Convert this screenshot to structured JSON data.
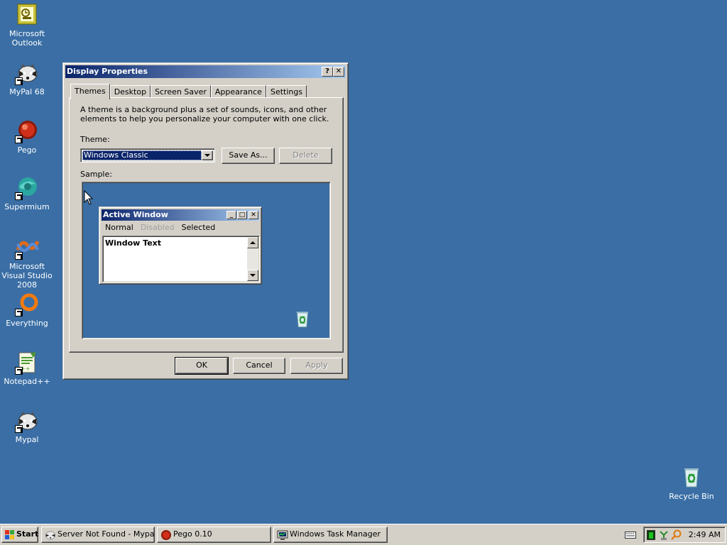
{
  "desktop": {
    "icons": [
      {
        "label": "Microsoft Outlook",
        "icon": "outlook-icon"
      },
      {
        "label": "MyPal 68",
        "icon": "mypal-icon"
      },
      {
        "label": "Pego",
        "icon": "pego-icon"
      },
      {
        "label": "Supermium",
        "icon": "supermium-icon"
      },
      {
        "label": "Microsoft Visual Studio 2008",
        "icon": "visual-studio-icon"
      },
      {
        "label": "Everything",
        "icon": "everything-icon"
      },
      {
        "label": "Notepad++",
        "icon": "notepad-plus-plus-icon"
      },
      {
        "label": "Mypal",
        "icon": "mypal-icon"
      },
      {
        "label": "Recycle Bin",
        "icon": "recycle-bin-icon"
      }
    ]
  },
  "dialog": {
    "title": "Display Properties",
    "help_button": "?",
    "close_button": "✕",
    "tabs": [
      "Themes",
      "Desktop",
      "Screen Saver",
      "Appearance",
      "Settings"
    ],
    "active_tab": "Themes",
    "description": "A theme is a background plus a set of sounds, icons, and other elements to help you personalize your computer with one click.",
    "theme_label": "Theme:",
    "theme_value": "Windows Classic",
    "save_as_label": "Save As...",
    "delete_label": "Delete",
    "sample_label": "Sample:",
    "sample_window": {
      "title": "Active Window",
      "menu": [
        "Normal",
        "Disabled",
        "Selected"
      ],
      "text": "Window Text"
    },
    "ok_label": "OK",
    "cancel_label": "Cancel",
    "apply_label": "Apply"
  },
  "taskbar": {
    "start_label": "Start",
    "tasks": [
      {
        "label": "Server Not Found - Mypal",
        "icon": "mypal-icon"
      },
      {
        "label": "Pego 0.10",
        "icon": "pego-icon"
      },
      {
        "label": "Windows Task Manager",
        "icon": "task-manager-icon"
      }
    ],
    "clock": "2:49 AM"
  },
  "colors": {
    "desktop": "#3a6ea5",
    "face": "#d4d0c8",
    "title_start": "#0a246a",
    "title_end": "#a6caf0"
  }
}
